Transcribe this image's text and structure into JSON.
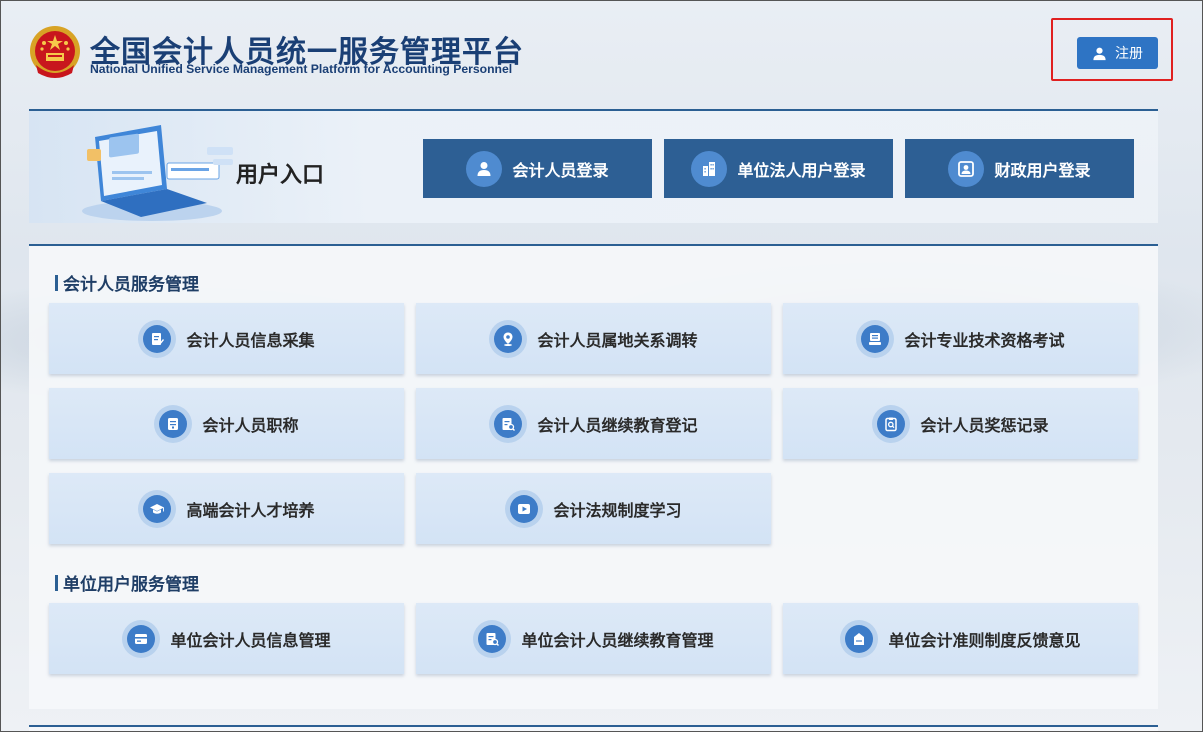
{
  "header": {
    "title": "全国会计人员统一服务管理平台",
    "subtitle": "National Unified Service Management Platform for Accounting Personnel",
    "register_label": "注册"
  },
  "entry": {
    "title": "用户入口",
    "buttons": [
      {
        "label": "会计人员登录",
        "icon": "user-icon"
      },
      {
        "label": "单位法人用户登录",
        "icon": "building-icon"
      },
      {
        "label": "财政用户登录",
        "icon": "id-card-icon"
      }
    ]
  },
  "sections": [
    {
      "title": "会计人员服务管理",
      "items": [
        {
          "label": "会计人员信息采集",
          "icon": "edit-document-icon"
        },
        {
          "label": "会计人员属地关系调转",
          "icon": "location-pin-icon"
        },
        {
          "label": "会计专业技术资格考试",
          "icon": "exam-icon"
        },
        {
          "label": "会计人员职称",
          "icon": "certificate-icon"
        },
        {
          "label": "会计人员继续教育登记",
          "icon": "document-search-icon"
        },
        {
          "label": "会计人员奖惩记录",
          "icon": "clipboard-search-icon"
        },
        {
          "label": "高端会计人才培养",
          "icon": "graduation-cap-icon"
        },
        {
          "label": "会计法规制度学习",
          "icon": "play-video-icon"
        }
      ]
    },
    {
      "title": "单位用户服务管理",
      "items": [
        {
          "label": "单位会计人员信息管理",
          "icon": "card-icon"
        },
        {
          "label": "单位会计人员继续教育管理",
          "icon": "document-search-icon"
        },
        {
          "label": "单位会计准则制度反馈意见",
          "icon": "feedback-icon"
        }
      ]
    }
  ],
  "colors": {
    "primary": "#2d5f94",
    "accent": "#2e74c4",
    "highlight": "#e02020",
    "card_bg": "#d3e3f5"
  }
}
